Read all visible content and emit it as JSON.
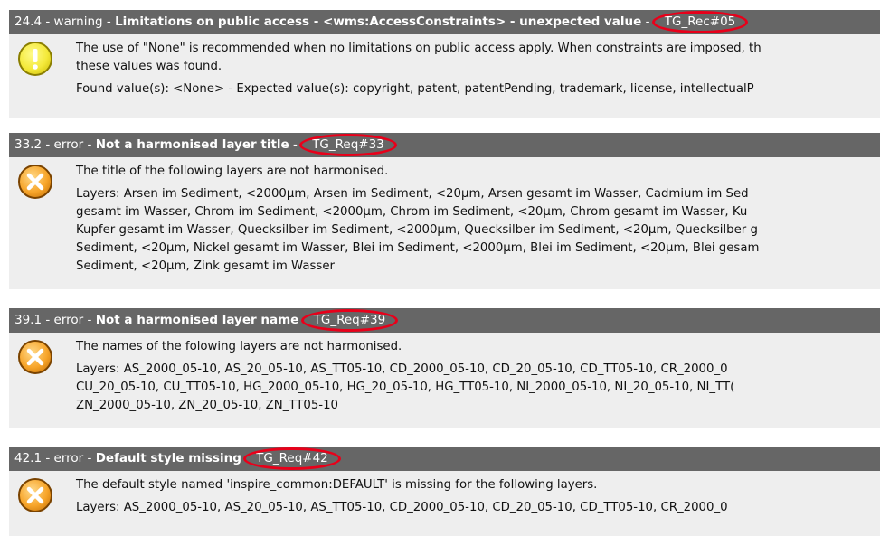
{
  "issues": [
    {
      "number": "24.4",
      "severity": "warning",
      "title": "Limitations on public access - <wms:AccessConstraints> - unexpected value",
      "tag": "TG_Rec#05",
      "icon": "warning-icon",
      "lines1": [
        "The use of \"None\" is recommended when no limitations on public access apply. When constraints are imposed, th",
        "these values was found."
      ],
      "lines2": [
        "Found value(s): <None> - Expected value(s): copyright, patent, patentPending, trademark, license, intellectualP"
      ]
    },
    {
      "number": "33.2",
      "severity": "error",
      "title": "Not a harmonised layer title",
      "tag": "TG_Req#33",
      "icon": "error-icon",
      "lines1": [
        "The title of the following layers are not harmonised."
      ],
      "lines2": [
        "Layers: Arsen im Sediment, <2000µm, Arsen im Sediment, <20µm, Arsen gesamt im Wasser, Cadmium im Sed",
        "gesamt im Wasser, Chrom im Sediment, <2000µm, Chrom im Sediment, <20µm, Chrom gesamt im Wasser, Ku",
        "Kupfer gesamt im Wasser, Quecksilber im Sediment, <2000µm, Quecksilber im Sediment, <20µm, Quecksilber g",
        "Sediment, <20µm, Nickel gesamt im Wasser, Blei im Sediment, <2000µm, Blei im Sediment, <20µm, Blei gesam",
        "Sediment, <20µm, Zink gesamt im Wasser"
      ]
    },
    {
      "number": "39.1",
      "severity": "error",
      "title": "Not a harmonised layer name",
      "tag": "TG_Req#39",
      "icon": "error-icon",
      "lines1": [
        "The names of the folowing layers are not harmonised."
      ],
      "lines2": [
        "Layers: AS_2000_05-10, AS_20_05-10, AS_TT05-10, CD_2000_05-10, CD_20_05-10, CD_TT05-10, CR_2000_0",
        "CU_20_05-10, CU_TT05-10, HG_2000_05-10, HG_20_05-10, HG_TT05-10, NI_2000_05-10, NI_20_05-10, NI_TT(",
        "ZN_2000_05-10, ZN_20_05-10, ZN_TT05-10"
      ]
    },
    {
      "number": "42.1",
      "severity": "error",
      "title": "Default style missing",
      "tag": "TG_Req#42",
      "icon": "error-icon",
      "lines1": [
        "The default style named 'inspire_common:DEFAULT' is missing for the following layers."
      ],
      "lines2": [
        "Layers: AS_2000_05-10, AS_20_05-10, AS_TT05-10, CD_2000_05-10, CD_20_05-10, CD_TT05-10, CR_2000_0"
      ]
    }
  ],
  "colors": {
    "header_bg": "#666666",
    "body_bg": "#eeeeee",
    "highlight": "#e8001a"
  }
}
